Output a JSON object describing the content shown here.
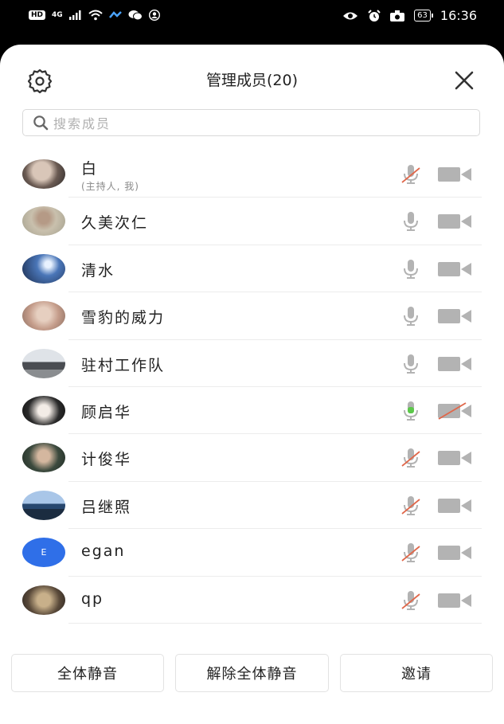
{
  "status_bar": {
    "hd_badge": "HD",
    "network": "4G",
    "battery": "63",
    "time": "16:36"
  },
  "header": {
    "title": "管理成员(20)",
    "settings_icon": "gear-icon",
    "close_icon": "close-icon"
  },
  "search": {
    "placeholder": "搜索成员"
  },
  "members": [
    {
      "name": "白",
      "note": "(主持人, 我)",
      "mic": "muted",
      "camera": "on",
      "avatar": "photo"
    },
    {
      "name": "久美次仁",
      "mic": "on",
      "camera": "on",
      "avatar": "photo"
    },
    {
      "name": "清水",
      "mic": "on",
      "camera": "on",
      "avatar": "photo"
    },
    {
      "name": "雪豹的威力",
      "mic": "on",
      "camera": "on",
      "avatar": "photo"
    },
    {
      "name": "驻村工作队",
      "mic": "on",
      "camera": "on",
      "avatar": "photo"
    },
    {
      "name": "顾启华",
      "mic": "speaking",
      "camera": "off",
      "avatar": "photo"
    },
    {
      "name": "计俊华",
      "mic": "muted",
      "camera": "on",
      "avatar": "photo"
    },
    {
      "name": "吕继照",
      "mic": "muted",
      "camera": "on",
      "avatar": "photo"
    },
    {
      "name": "egan",
      "mic": "muted",
      "camera": "on",
      "avatar": "letter",
      "initial": "E"
    },
    {
      "name": "qp",
      "mic": "muted",
      "camera": "on",
      "avatar": "photo"
    }
  ],
  "footer": {
    "mute_all": "全体静音",
    "unmute_all": "解除全体静音",
    "invite": "邀请"
  },
  "colors": {
    "muted_slash": "#e0674a",
    "speaking": "#5cc84a",
    "icon_gray": "#b3b3b3",
    "letter_avatar": "#2f6fe8"
  }
}
